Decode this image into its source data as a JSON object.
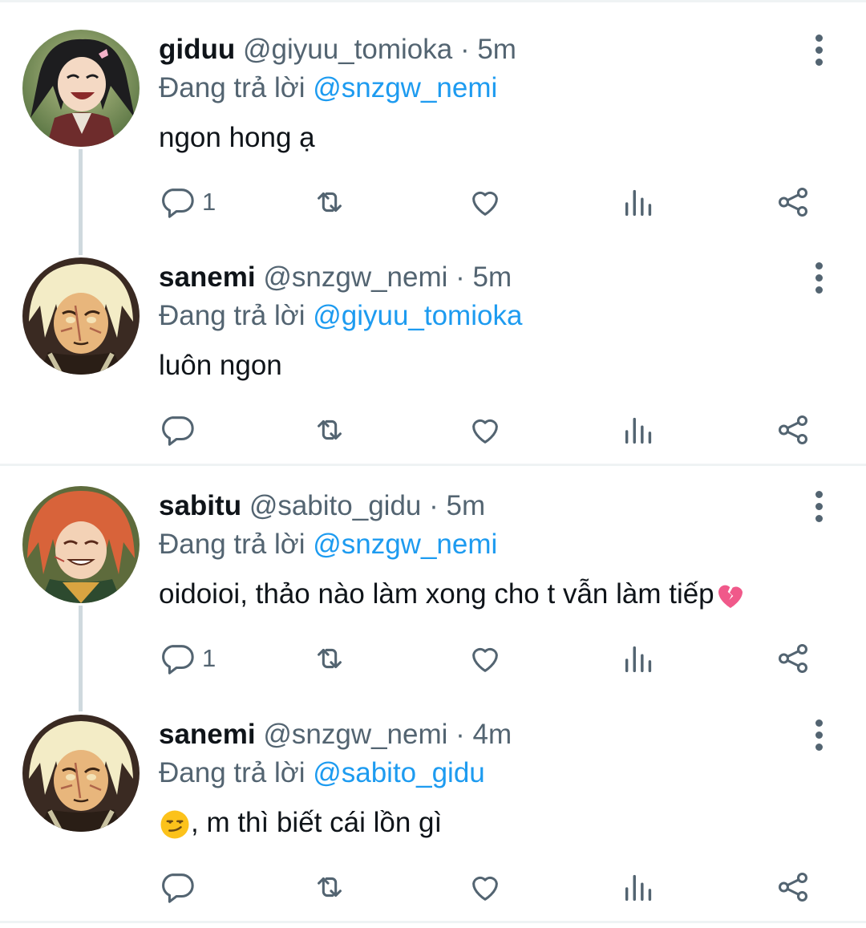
{
  "tweets": [
    {
      "display_name": "giduu",
      "handle": "@giyuu_tomioka",
      "time": "· 5m",
      "reply_prefix": "Đang trả lời",
      "reply_to": "@snzgw_nemi",
      "text": "ngon hong ạ",
      "reply_count": "1",
      "avatar": "avatar-dark-hair-character"
    },
    {
      "display_name": "sanemi",
      "handle": "@snzgw_nemi",
      "time": "· 5m",
      "reply_prefix": "Đang trả lời",
      "reply_to": "@giyuu_tomioka",
      "text": "luôn ngon",
      "reply_count": "",
      "avatar": "avatar-blonde-scarred-character"
    },
    {
      "display_name": "sabitu",
      "handle": "@sabito_gidu",
      "time": "· 5m",
      "reply_prefix": "Đang trả lời",
      "reply_to": "@snzgw_nemi",
      "text": "oidoioi, thảo nào làm xong cho t vẫn làm tiếp",
      "text_emoji": "broken-heart-emoji",
      "reply_count": "1",
      "avatar": "avatar-orange-hair-character"
    },
    {
      "display_name": "sanemi",
      "handle": "@snzgw_nemi",
      "time": "· 4m",
      "reply_prefix": "Đang trả lời",
      "reply_to": "@sabito_gidu",
      "text_emoji": "smirking-face-emoji",
      "text": ", m thì biết cái lồn gì",
      "reply_count": "",
      "avatar": "avatar-blonde-scarred-character"
    }
  ],
  "icons": {
    "reply": "reply-icon",
    "retweet": "retweet-icon",
    "like": "heart-icon",
    "views": "views-chart-icon",
    "share": "share-icon",
    "more": "more-vertical-icon"
  },
  "colors": {
    "text_primary": "#0f1419",
    "text_secondary": "#536471",
    "mention": "#1d9bf0",
    "thread_line": "#cfd9de",
    "divider": "#eff3f4"
  }
}
